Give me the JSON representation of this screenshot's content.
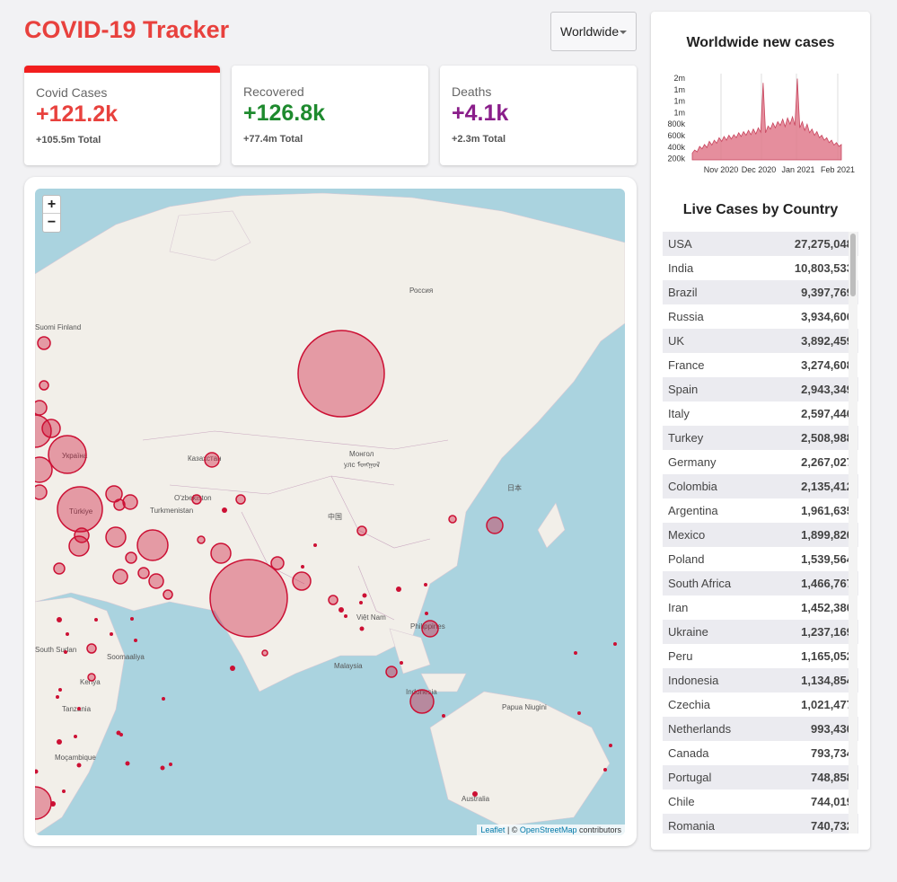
{
  "app": {
    "title": "COVID-19 Tracker"
  },
  "region_select": {
    "value": "Worldwide"
  },
  "stats": [
    {
      "label": "Covid Cases",
      "value": "+121.2k",
      "total": "+105.5m Total",
      "color": "#e8413d",
      "active": true
    },
    {
      "label": "Recovered",
      "value": "+126.8k",
      "total": "+77.4m Total",
      "color": "#1e8a2e",
      "active": false
    },
    {
      "label": "Deaths",
      "value": "+4.1k",
      "total": "+2.3m Total",
      "color": "#8a1e8a",
      "active": false
    }
  ],
  "map": {
    "zoom_in": "+",
    "zoom_out": "−",
    "attribution": {
      "leaflet": "Leaflet",
      "sep": " | © ",
      "osm": "OpenStreetMap",
      "suffix": " contributors"
    },
    "labels": {
      "russia": "Россия",
      "mongolia": "Монгол",
      "mongolia2": "улс ᠮᠣᠩᠭᠣᠯ",
      "japan": "日本",
      "china": "中国",
      "turkey": "Türkiye",
      "ukraine": "Україна",
      "kazakhstan": "Казахстан",
      "uzbekistan": "O'zbekiston",
      "turkmenistan": "Turkmenistan",
      "vietnam": "Việt Nam",
      "philippines": "Philippines",
      "malaysia": "Malaysia",
      "indonesia": "Indonesia",
      "papua": "Papua Niugini",
      "australia": "Australia",
      "south_sudan": "South Sudan",
      "somalia": "Soomaaliya",
      "kenya": "Kenya",
      "tanzania": "Tanzania",
      "mozambique": "Moçambique",
      "finland": "Suomi Finland"
    },
    "bubble_color": "#cc1034"
  },
  "chart": {
    "title": "Worldwide new cases",
    "chart_data": {
      "type": "area",
      "x_ticks": [
        "Nov 2020",
        "Dec 2020",
        "Jan 2021",
        "Feb 2021"
      ],
      "y_ticks": [
        "200k",
        "400k",
        "600k",
        "800k",
        "1m",
        "1m",
        "1m",
        "2m"
      ],
      "ylim": [
        200000,
        1600000
      ],
      "color": "#e07a8c",
      "values": [
        310000,
        360000,
        330000,
        420000,
        380000,
        450000,
        400000,
        500000,
        440000,
        520000,
        470000,
        560000,
        500000,
        580000,
        520000,
        600000,
        540000,
        610000,
        560000,
        640000,
        580000,
        660000,
        600000,
        680000,
        610000,
        700000,
        620000,
        720000,
        650000,
        1450000,
        640000,
        750000,
        700000,
        800000,
        720000,
        820000,
        760000,
        860000,
        740000,
        880000,
        780000,
        900000,
        760000,
        1520000,
        720000,
        820000,
        680000,
        780000,
        640000,
        700000,
        600000,
        660000,
        560000,
        600000,
        520000,
        560000,
        480000,
        520000,
        440000,
        480000,
        420000,
        450000
      ]
    }
  },
  "table": {
    "title": "Live Cases by Country",
    "rows": [
      {
        "country": "USA",
        "cases": "27,275,048"
      },
      {
        "country": "India",
        "cases": "10,803,533"
      },
      {
        "country": "Brazil",
        "cases": "9,397,769"
      },
      {
        "country": "Russia",
        "cases": "3,934,606"
      },
      {
        "country": "UK",
        "cases": "3,892,459"
      },
      {
        "country": "France",
        "cases": "3,274,608"
      },
      {
        "country": "Spain",
        "cases": "2,943,349"
      },
      {
        "country": "Italy",
        "cases": "2,597,446"
      },
      {
        "country": "Turkey",
        "cases": "2,508,988"
      },
      {
        "country": "Germany",
        "cases": "2,267,027"
      },
      {
        "country": "Colombia",
        "cases": "2,135,412"
      },
      {
        "country": "Argentina",
        "cases": "1,961,635"
      },
      {
        "country": "Mexico",
        "cases": "1,899,820"
      },
      {
        "country": "Poland",
        "cases": "1,539,564"
      },
      {
        "country": "South Africa",
        "cases": "1,466,767"
      },
      {
        "country": "Iran",
        "cases": "1,452,380"
      },
      {
        "country": "Ukraine",
        "cases": "1,237,169"
      },
      {
        "country": "Peru",
        "cases": "1,165,052"
      },
      {
        "country": "Indonesia",
        "cases": "1,134,854"
      },
      {
        "country": "Czechia",
        "cases": "1,021,477"
      },
      {
        "country": "Netherlands",
        "cases": "993,430"
      },
      {
        "country": "Canada",
        "cases": "793,734"
      },
      {
        "country": "Portugal",
        "cases": "748,858"
      },
      {
        "country": "Chile",
        "cases": "744,019"
      },
      {
        "country": "Romania",
        "cases": "740,732"
      }
    ]
  }
}
